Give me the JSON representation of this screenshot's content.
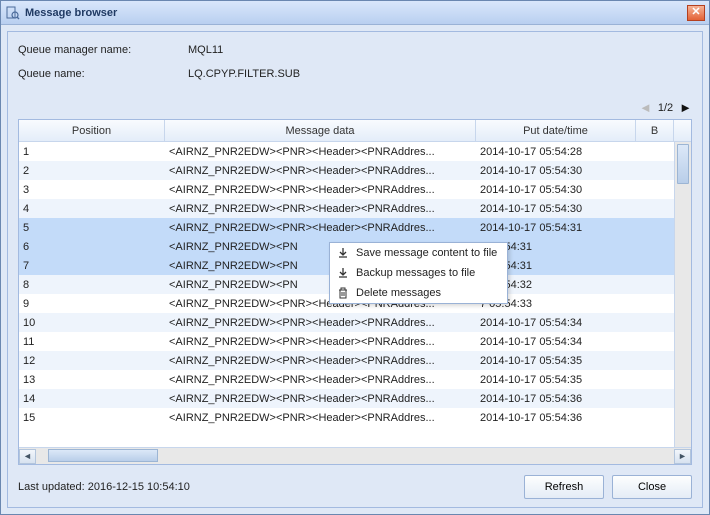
{
  "window": {
    "title": "Message browser"
  },
  "info": {
    "qm_label": "Queue manager name:",
    "qm_value": "MQL11",
    "q_label": "Queue name:",
    "q_value": "LQ.CPYP.FILTER.SUB"
  },
  "pager": {
    "text": "1/2"
  },
  "columns": {
    "position": "Position",
    "message": "Message data",
    "put": "Put date/time",
    "b": "B"
  },
  "rows": [
    {
      "pos": "1",
      "msg": "<AIRNZ_PNR2EDW><PNR><Header><PNRAddres...",
      "put": "2014-10-17 05:54:28",
      "sel": false
    },
    {
      "pos": "2",
      "msg": "<AIRNZ_PNR2EDW><PNR><Header><PNRAddres...",
      "put": "2014-10-17 05:54:30",
      "sel": false
    },
    {
      "pos": "3",
      "msg": "<AIRNZ_PNR2EDW><PNR><Header><PNRAddres...",
      "put": "2014-10-17 05:54:30",
      "sel": false
    },
    {
      "pos": "4",
      "msg": "<AIRNZ_PNR2EDW><PNR><Header><PNRAddres...",
      "put": "2014-10-17 05:54:30",
      "sel": false
    },
    {
      "pos": "5",
      "msg": "<AIRNZ_PNR2EDW><PNR><Header><PNRAddres...",
      "put": "2014-10-17 05:54:31",
      "sel": true
    },
    {
      "pos": "6",
      "msg": "<AIRNZ_PNR2EDW><PN",
      "put": "7 05:54:31",
      "sel": true
    },
    {
      "pos": "7",
      "msg": "<AIRNZ_PNR2EDW><PN",
      "put": "7 05:54:31",
      "sel": true
    },
    {
      "pos": "8",
      "msg": "<AIRNZ_PNR2EDW><PN",
      "put": "7 05:54:32",
      "sel": false
    },
    {
      "pos": "9",
      "msg": "<AIRNZ_PNR2EDW><PNR><Header><PNRAddres...",
      "put": "7 05:54:33",
      "sel": false,
      "partial_put": true
    },
    {
      "pos": "10",
      "msg": "<AIRNZ_PNR2EDW><PNR><Header><PNRAddres...",
      "put": "2014-10-17 05:54:34",
      "sel": false
    },
    {
      "pos": "11",
      "msg": "<AIRNZ_PNR2EDW><PNR><Header><PNRAddres...",
      "put": "2014-10-17 05:54:34",
      "sel": false
    },
    {
      "pos": "12",
      "msg": "<AIRNZ_PNR2EDW><PNR><Header><PNRAddres...",
      "put": "2014-10-17 05:54:35",
      "sel": false
    },
    {
      "pos": "13",
      "msg": "<AIRNZ_PNR2EDW><PNR><Header><PNRAddres...",
      "put": "2014-10-17 05:54:35",
      "sel": false
    },
    {
      "pos": "14",
      "msg": "<AIRNZ_PNR2EDW><PNR><Header><PNRAddres...",
      "put": "2014-10-17 05:54:36",
      "sel": false
    },
    {
      "pos": "15",
      "msg": "<AIRNZ_PNR2EDW><PNR><Header><PNRAddres...",
      "put": "2014-10-17 05:54:36",
      "sel": false
    }
  ],
  "context_menu": {
    "save": "Save message content to file",
    "backup": "Backup messages to file",
    "delete": "Delete messages"
  },
  "footer": {
    "last_updated_label": "Last updated:",
    "last_updated_value": "2016-12-15 10:54:10",
    "refresh": "Refresh",
    "close": "Close"
  }
}
